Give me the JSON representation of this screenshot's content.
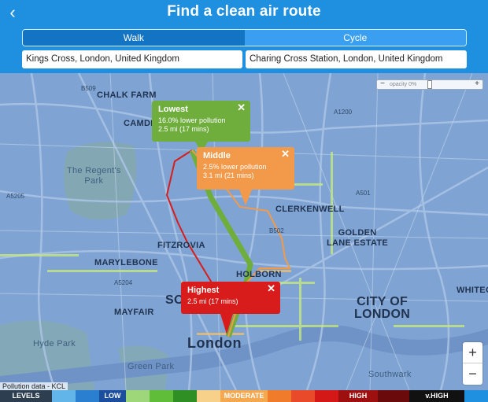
{
  "header": {
    "title": "Find a clean air route",
    "back_icon": "chevron-left-icon"
  },
  "mode_tabs": [
    {
      "label": "Walk",
      "active": true
    },
    {
      "label": "Cycle",
      "active": false
    }
  ],
  "route": {
    "from": "Kings Cross, London, United Kingdom",
    "to": "Charing Cross Station, London, United Kingdom"
  },
  "opacity_control": {
    "label": "opacity 0%",
    "minus": "−",
    "plus": "+",
    "value": 0.0
  },
  "map_labels": {
    "chalk_farm": "CHALK FARM",
    "camden": "CAMDE",
    "regents_park": "The Regent's\nPark",
    "clerkenwell": "CLERKENWELL",
    "golden_lane": "GOLDEN\nLANE ESTATE",
    "fitzrovia": "FITZROVIA",
    "marylebone": "MARYLEBONE",
    "holborn": "HOLBORN",
    "city_of_london": "CITY OF\nLONDON",
    "mayfair": "MAYFAIR",
    "london": "London",
    "hyde_park": "Hyde Park",
    "green_park": "Green Park",
    "southwark": "Southwark",
    "whitecha": "WHITEC",
    "so": "SO",
    "b509": "B509",
    "a5205": "A5205",
    "a501": "A501",
    "a5204": "A5204",
    "b502": "B502",
    "a1200": "A1200"
  },
  "popups": [
    {
      "name": "Lowest",
      "line1": "16.0% lower pollution",
      "line2": "2.5 mi (17 mins)",
      "color": "#6fae3d"
    },
    {
      "name": "Middle",
      "line1": "2.5% lower pollution",
      "line2": "3.1 mi (21 mins)",
      "color": "#f39a4a"
    },
    {
      "name": "Highest",
      "line1": "2.5 mi (17 mins)",
      "line2": "",
      "color": "#d81c1c"
    }
  ],
  "zoom": {
    "in": "+",
    "out": "−"
  },
  "credit": "Pollution data - KCL",
  "legend": {
    "label": "LEVELS",
    "low": "LOW",
    "moderate": "MODERATE",
    "high": "HIGH",
    "vhigh": "v.HIGH",
    "colors": [
      "#2c3e50",
      "#62b5e8",
      "#2a7fd0",
      "#1b4f9e",
      "#9dd77a",
      "#5fbd3a",
      "#2f8f24",
      "#f7d08a",
      "#f4a850",
      "#f07b2a",
      "#e84a2a",
      "#d41818",
      "#9e0f0f",
      "#6a0a0a",
      "#111111"
    ]
  }
}
